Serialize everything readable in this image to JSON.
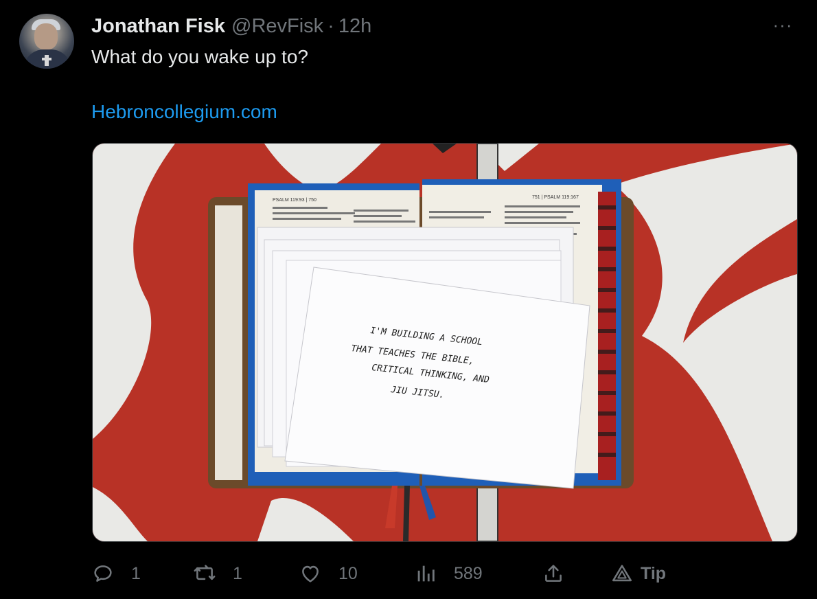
{
  "tweet": {
    "author_name": "Jonathan Fisk",
    "handle": "@RevFisk",
    "separator": "·",
    "time": "12h",
    "more_label": "···",
    "text": "What do you wake up to?",
    "link": "Hebroncollegium.com"
  },
  "image": {
    "note_lines": [
      "I'M BUILDING A SCHOOL",
      "THAT TEACHES THE BIBLE,",
      "CRITICAL THINKING, AND",
      "JIU JITSU."
    ],
    "page_header_left": "PSALM 119:93 | 750",
    "page_header_right": "751 | PSALM 119:167"
  },
  "actions": {
    "reply_count": "1",
    "repost_count": "1",
    "like_count": "10",
    "views_count": "589",
    "tip_label": "Tip"
  },
  "colors": {
    "link": "#1d9bf0",
    "secondary_text": "#71767b",
    "primary_text": "#e7e9ea",
    "background": "#000000"
  }
}
